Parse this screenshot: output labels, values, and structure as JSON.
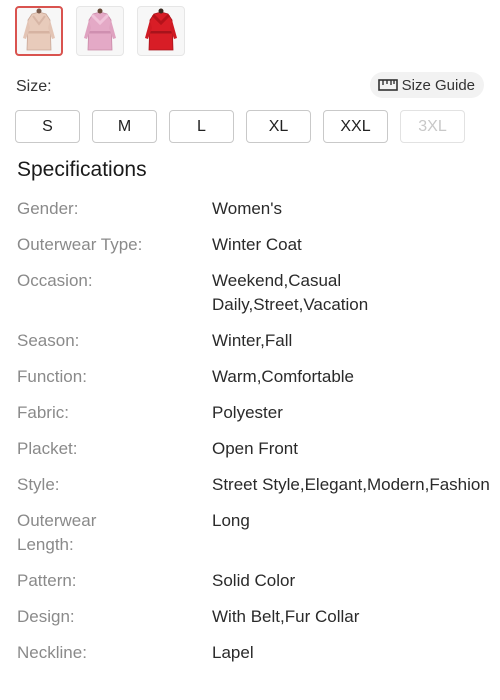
{
  "swatches": [
    {
      "name": "beige-coat",
      "color": "#e7c9b8",
      "selected": true
    },
    {
      "name": "pink-coat",
      "color": "#e2a6c3",
      "selected": false
    },
    {
      "name": "red-coat",
      "color": "#d81d26",
      "selected": false
    }
  ],
  "size_section": {
    "label": "Size:",
    "guide_label": "Size Guide",
    "options": [
      {
        "label": "S",
        "available": true
      },
      {
        "label": "M",
        "available": true
      },
      {
        "label": "L",
        "available": true
      },
      {
        "label": "XL",
        "available": true
      },
      {
        "label": "XXL",
        "available": true
      },
      {
        "label": "3XL",
        "available": false
      }
    ]
  },
  "specifications": {
    "title": "Specifications",
    "rows": [
      {
        "key": "Gender:",
        "value": "Women's"
      },
      {
        "key": "Outerwear Type:",
        "value": "Winter Coat"
      },
      {
        "key": "Occasion:",
        "value": "Weekend,Casual Daily,Street,Vacation"
      },
      {
        "key": "Season:",
        "value": "Winter,Fall"
      },
      {
        "key": "Function:",
        "value": "Warm,Comfortable"
      },
      {
        "key": "Fabric:",
        "value": "Polyester"
      },
      {
        "key": "Placket:",
        "value": "Open Front"
      },
      {
        "key": "Style:",
        "value": "Street Style,Elegant,Modern,Fashion"
      },
      {
        "key": "Outerwear Length:",
        "value": "Long"
      },
      {
        "key": "Pattern:",
        "value": "Solid Color"
      },
      {
        "key": "Design:",
        "value": "With Belt,Fur Collar"
      },
      {
        "key": "Neckline:",
        "value": "Lapel"
      }
    ]
  }
}
